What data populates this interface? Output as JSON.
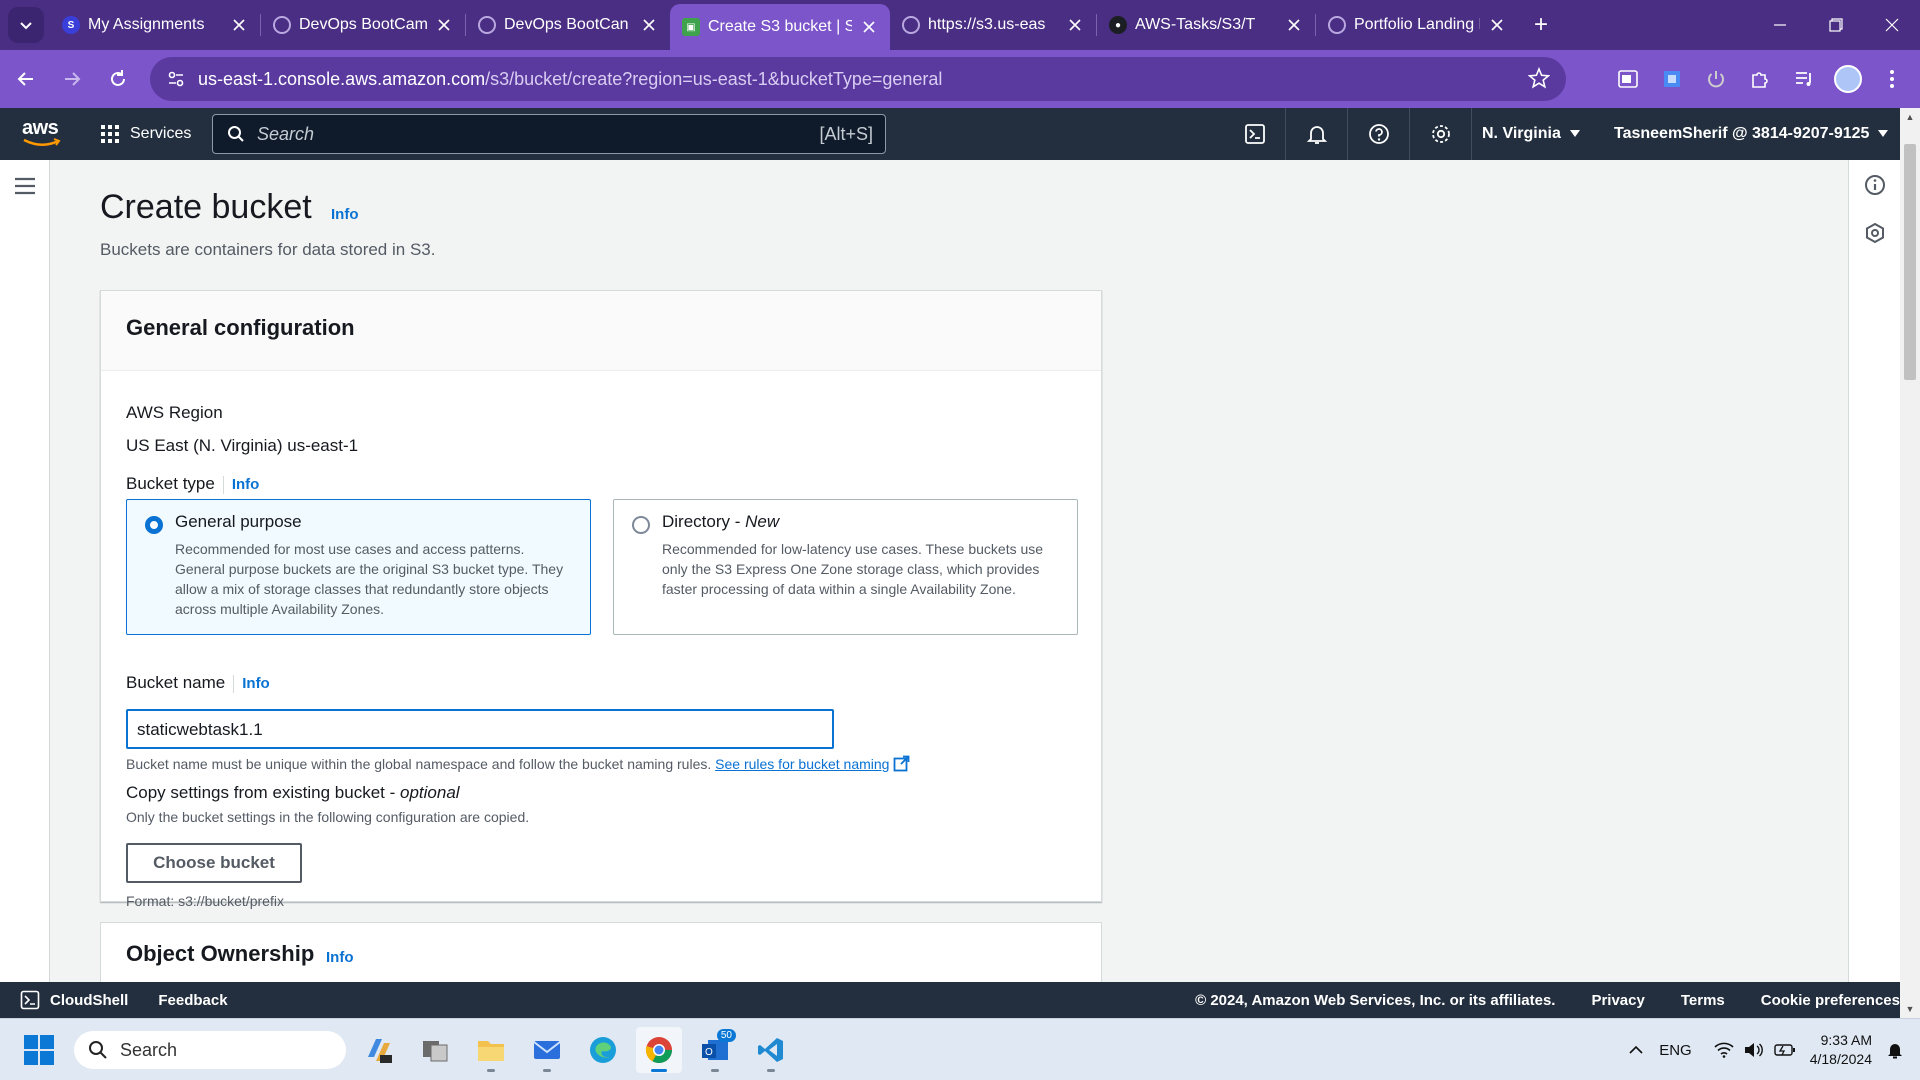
{
  "browser": {
    "tabs": [
      {
        "label": "My Assignments",
        "favicon": "s-logo",
        "active": false
      },
      {
        "label": "DevOps BootCamp |",
        "favicon": "globe",
        "active": false
      },
      {
        "label": "DevOps BootCan",
        "favicon": "globe",
        "active": false
      },
      {
        "label": "Create S3 bucket | S",
        "favicon": "s3",
        "active": true
      },
      {
        "label": "https://s3.us-eas",
        "favicon": "globe",
        "active": false
      },
      {
        "label": "AWS-Tasks/S3/T",
        "favicon": "github",
        "active": false
      },
      {
        "label": "Portfolio Landing Pa",
        "favicon": "globe",
        "active": false
      }
    ],
    "url_host": "us-east-1.console.aws.amazon.com",
    "url_path": "/s3/bucket/create?region=us-east-1&bucketType=general"
  },
  "aws_nav": {
    "logo": "aws",
    "services": "Services",
    "search_placeholder": "Search",
    "search_shortcut": "[Alt+S]",
    "region": "N. Virginia",
    "account": "TasneemSherif @ 3814-9207-9125"
  },
  "page": {
    "title": "Create bucket",
    "info": "Info",
    "description": "Buckets are containers for data stored in S3."
  },
  "general": {
    "heading": "General configuration",
    "region_label": "AWS Region",
    "region_value": "US East (N. Virginia) us-east-1",
    "bucket_type_label": "Bucket type",
    "info": "Info",
    "options": {
      "general": {
        "title": "General purpose",
        "description": "Recommended for most use cases and access patterns. General purpose buckets are the original S3 bucket type. They allow a mix of storage classes that redundantly store objects across multiple Availability Zones.",
        "selected": true
      },
      "directory": {
        "title": "Directory - ",
        "title_tag": "New",
        "description": "Recommended for low-latency use cases. These buckets use only the S3 Express One Zone storage class, which provides faster processing of data within a single Availability Zone.",
        "selected": false
      }
    },
    "bucket_name_label": "Bucket name",
    "bucket_name_value": "staticwebtask1.1",
    "bucket_name_hint": "Bucket name must be unique within the global namespace and follow the bucket naming rules.",
    "rules_link": "See rules for bucket naming",
    "copy_label": "Copy settings from existing bucket - ",
    "copy_optional": "optional",
    "copy_hint": "Only the bucket settings in the following configuration are copied.",
    "choose_button": "Choose bucket",
    "format_hint": "Format: s3://bucket/prefix"
  },
  "ownership": {
    "heading": "Object Ownership",
    "info": "Info"
  },
  "footer": {
    "cloudshell": "CloudShell",
    "feedback": "Feedback",
    "copyright": "© 2024, Amazon Web Services, Inc. or its affiliates.",
    "privacy": "Privacy",
    "terms": "Terms",
    "cookies": "Cookie preferences"
  },
  "taskbar": {
    "search": "Search",
    "language": "ENG",
    "time": "9:33 AM",
    "date": "4/18/2024",
    "mail_badge": "50"
  },
  "colors": {
    "aws_nav": "#232f3e",
    "link": "#0972d3",
    "browser_frame": "#7b55c9"
  }
}
